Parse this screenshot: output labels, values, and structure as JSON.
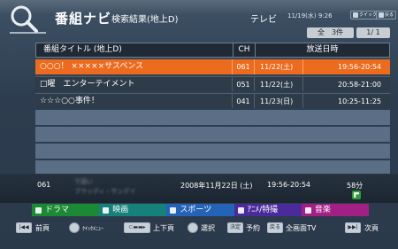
{
  "header": {
    "app_title": "番組ナビ",
    "screen_title": "検索結果(地上D)",
    "source": "テレビ",
    "datetime": "11/19(水) 9:26",
    "btn_quick": "クイックモード",
    "btn_back": "戻る",
    "count": "全　3件",
    "page": "1/ 1"
  },
  "table": {
    "columns": {
      "title": "番組タイトル (地上D)",
      "ch": "CH",
      "airtime": "放送日時"
    },
    "rows": [
      {
        "title": "○○○！ ×××××サスペンス",
        "ch": "061",
        "date": "11/22(土)",
        "time": "19:56-20:54",
        "selected": true
      },
      {
        "title": "□曜　エンターテイメント",
        "ch": "051",
        "date": "11/22(土)",
        "time": "20:58-21:00",
        "selected": false
      },
      {
        "title": "☆☆☆○○事件！",
        "ch": "041",
        "date": "11/23(日)",
        "time": "10:25-11:25",
        "selected": false
      }
    ],
    "empty_rows": 5
  },
  "detail": {
    "channel": "061",
    "blurred_line1": "で話い",
    "blurred_line2": "ブラッディ・サンデイ",
    "date": "2008年11月22日 (土)",
    "time": "19:56-20:54",
    "duration": "58分"
  },
  "genres": [
    {
      "label": "ドラマ"
    },
    {
      "label": "映画"
    },
    {
      "label": "スポーツ"
    },
    {
      "label": "ｱﾆﾒ/特撮"
    },
    {
      "label": "音楽"
    }
  ],
  "footer": {
    "prev_page": "前頁",
    "quick_menu": "ｸｲｯｸﾒﾆｭｰ",
    "updown_page": "上下頁",
    "select": "選択",
    "key_decide": "決定",
    "reserve": "予約",
    "key_back": "戻る",
    "fullscreen_tv": "全画面TV",
    "next_page": "次頁"
  }
}
